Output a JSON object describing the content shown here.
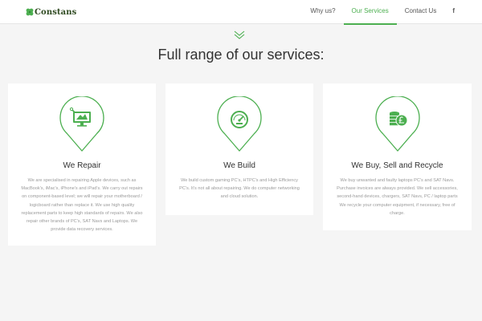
{
  "brand": {
    "logo_text": "Constans",
    "logo_icon": "four-leaf-clover-icon"
  },
  "nav": {
    "items": [
      {
        "label": "Why us?",
        "active": false
      },
      {
        "label": "Our Services",
        "active": true
      },
      {
        "label": "Contact Us",
        "active": false
      }
    ],
    "social_label": "f",
    "social_icon": "facebook-icon"
  },
  "section": {
    "title": "Full range of our services:",
    "icon": "chevron-down-icon"
  },
  "services": [
    {
      "title": "We Repair",
      "icon": "monitor-repair-icon",
      "text": "We are specialised in repairing Apple devices, such as MacBook's, iMac's, iPhone's and iPad's. We carry out repairs on component-based level; we will repair your motherboard / logicboard rather than replace it. We use high quality replacement parts to keep high standards of repairs. We also repair other brands of PC's, SAT Navs and Laptops. We provide data recovery services."
    },
    {
      "title": "We Build",
      "icon": "speedometer-icon",
      "text": "We build custom gaming PC's, HTPC's and High Efficiency PC's. It's not all about repairing. We do computer networking and cloud solution."
    },
    {
      "title": "We Buy, Sell and Recycle",
      "icon": "coins-pound-icon",
      "text": "We buy unwanted and faulty laptops PC's and SAT Navs. Purchase invoices are always provided. We sell accessories, second-hand devices, chargers, SAT Navs, PC / laptop parts We recycle your computer equipment, if necessary, free of charge."
    }
  ],
  "colors": {
    "accent": "#4caf50",
    "background": "#f5f5f5",
    "card": "#ffffff",
    "heading": "#333333",
    "body_text": "#9a9a9a"
  }
}
